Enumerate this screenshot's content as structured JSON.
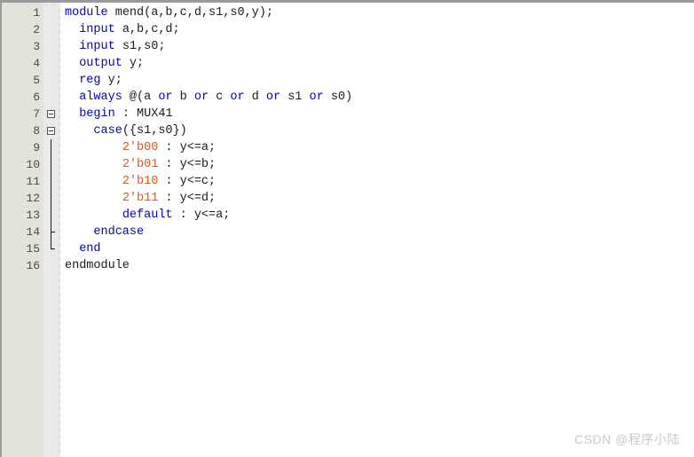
{
  "editor": {
    "language": "verilog",
    "colors": {
      "keyword": "#0000c8",
      "literal": "#cf5b22",
      "plain": "#1a1a1a",
      "gutter_background": "#e3e3db",
      "gutter_text": "#4d4a42",
      "code_background": "#ffffff",
      "watermark_text": "#c9c9c9",
      "window_border": "#9a9a9a"
    },
    "gutter": {
      "line_numbers": [
        "1",
        "2",
        "3",
        "4",
        "5",
        "6",
        "7",
        "8",
        "9",
        "10",
        "11",
        "12",
        "13",
        "14",
        "15",
        "16"
      ]
    },
    "fold_markers": [
      {
        "line": 7,
        "type": "collapse-box"
      },
      {
        "line": 8,
        "type": "collapse-box"
      },
      {
        "line": 9,
        "type": "stem"
      },
      {
        "line": 10,
        "type": "stem"
      },
      {
        "line": 11,
        "type": "stem"
      },
      {
        "line": 12,
        "type": "stem"
      },
      {
        "line": 13,
        "type": "stem"
      },
      {
        "line": 14,
        "type": "branch-tick"
      },
      {
        "line": 15,
        "type": "end-corner"
      }
    ],
    "lines": [
      {
        "number": "1",
        "indent": 0,
        "tokens": [
          {
            "text": "module ",
            "type": "keyword"
          },
          {
            "text": "mend(a,b,c,d,s1,s0,y);",
            "type": "plain"
          }
        ]
      },
      {
        "number": "2",
        "indent": 2,
        "tokens": [
          {
            "text": "input ",
            "type": "keyword"
          },
          {
            "text": "a,b,c,d;",
            "type": "plain"
          }
        ]
      },
      {
        "number": "3",
        "indent": 2,
        "tokens": [
          {
            "text": "input ",
            "type": "keyword"
          },
          {
            "text": "s1,s0;",
            "type": "plain"
          }
        ]
      },
      {
        "number": "4",
        "indent": 2,
        "tokens": [
          {
            "text": "output ",
            "type": "keyword"
          },
          {
            "text": "y;",
            "type": "plain"
          }
        ]
      },
      {
        "number": "5",
        "indent": 2,
        "tokens": [
          {
            "text": "reg ",
            "type": "keyword"
          },
          {
            "text": "y;",
            "type": "plain"
          }
        ]
      },
      {
        "number": "6",
        "indent": 2,
        "tokens": [
          {
            "text": "always ",
            "type": "keyword"
          },
          {
            "text": "@(a ",
            "type": "plain"
          },
          {
            "text": "or ",
            "type": "keyword"
          },
          {
            "text": "b ",
            "type": "plain"
          },
          {
            "text": "or ",
            "type": "keyword"
          },
          {
            "text": "c ",
            "type": "plain"
          },
          {
            "text": "or ",
            "type": "keyword"
          },
          {
            "text": "d ",
            "type": "plain"
          },
          {
            "text": "or ",
            "type": "keyword"
          },
          {
            "text": "s1 ",
            "type": "plain"
          },
          {
            "text": "or ",
            "type": "keyword"
          },
          {
            "text": "s0)",
            "type": "plain"
          }
        ]
      },
      {
        "number": "7",
        "indent": 2,
        "tokens": [
          {
            "text": "begin ",
            "type": "keyword"
          },
          {
            "text": ": MUX41",
            "type": "plain"
          }
        ]
      },
      {
        "number": "8",
        "indent": 4,
        "tokens": [
          {
            "text": "case",
            "type": "keyword"
          },
          {
            "text": "({s1,s0})",
            "type": "plain"
          }
        ]
      },
      {
        "number": "9",
        "indent": 8,
        "tokens": [
          {
            "text": "2'b00",
            "type": "literal"
          },
          {
            "text": " : y<=a;",
            "type": "plain"
          }
        ]
      },
      {
        "number": "10",
        "indent": 8,
        "tokens": [
          {
            "text": "2'b01",
            "type": "literal"
          },
          {
            "text": " : y<=b;",
            "type": "plain"
          }
        ]
      },
      {
        "number": "11",
        "indent": 8,
        "tokens": [
          {
            "text": "2'b10",
            "type": "literal"
          },
          {
            "text": " : y<=c;",
            "type": "plain"
          }
        ]
      },
      {
        "number": "12",
        "indent": 8,
        "tokens": [
          {
            "text": "2'b11",
            "type": "literal"
          },
          {
            "text": " : y<=d;",
            "type": "plain"
          }
        ]
      },
      {
        "number": "13",
        "indent": 8,
        "tokens": [
          {
            "text": "default",
            "type": "keyword"
          },
          {
            "text": " : y<=a;",
            "type": "plain"
          }
        ]
      },
      {
        "number": "14",
        "indent": 4,
        "tokens": [
          {
            "text": "endcase",
            "type": "keyword"
          }
        ]
      },
      {
        "number": "15",
        "indent": 2,
        "tokens": [
          {
            "text": "end",
            "type": "keyword"
          }
        ]
      },
      {
        "number": "16",
        "indent": 0,
        "tokens": [
          {
            "text": "endmodule",
            "type": "plain"
          }
        ]
      }
    ]
  },
  "watermark": {
    "text": "CSDN @程序小陆"
  }
}
